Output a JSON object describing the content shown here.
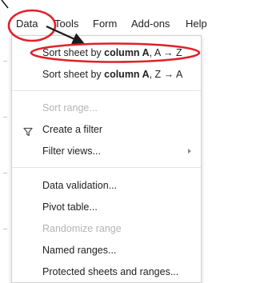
{
  "menubar": {
    "items": [
      "Data",
      "Tools",
      "Form",
      "Add-ons",
      "Help"
    ]
  },
  "menu": {
    "sort_az": {
      "prefix": "Sort sheet by ",
      "column": "column A",
      "suffix": ", A → Z"
    },
    "sort_za": {
      "prefix": "Sort sheet by ",
      "column": "column A",
      "suffix": ", Z → A"
    },
    "sort_range": "Sort range...",
    "create_filter": "Create a filter",
    "filter_views": "Filter views...",
    "data_validation": "Data validation...",
    "pivot_table": "Pivot table...",
    "randomize_range": "Randomize range",
    "named_ranges": "Named ranges...",
    "protected": "Protected sheets and ranges..."
  },
  "annotation_color": "#e0202a",
  "icons": {
    "filter": "filter-icon",
    "submenu": "submenu-arrow-icon"
  }
}
